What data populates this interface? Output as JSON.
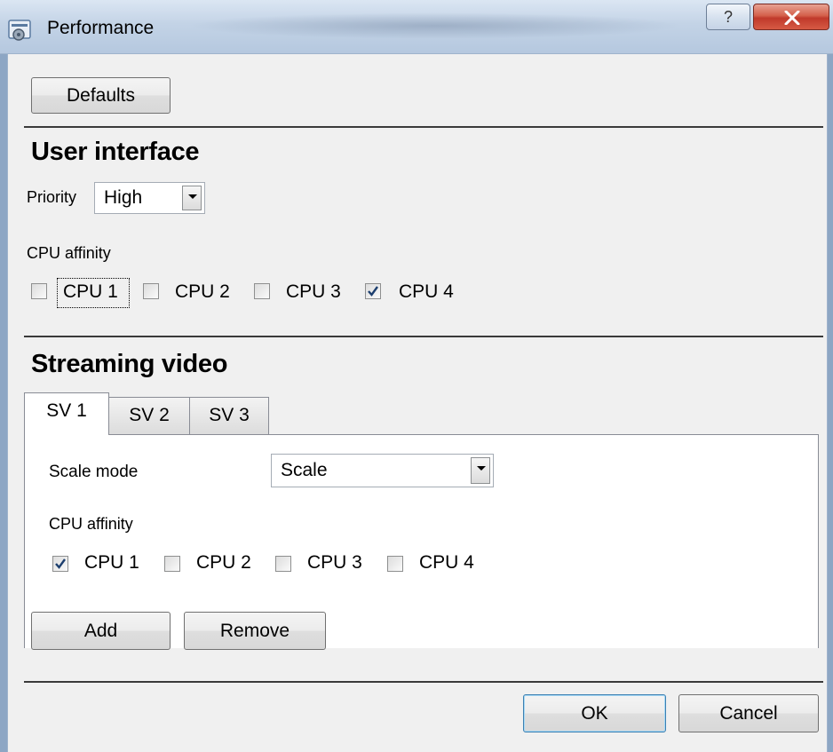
{
  "window": {
    "title": "Performance",
    "help_glyph": "?",
    "icons": {
      "app": "performance-app-icon",
      "help": "help-icon",
      "close": "close-icon"
    }
  },
  "defaults_button": "Defaults",
  "user_interface": {
    "heading": "User interface",
    "priority_label": "Priority",
    "priority_value": "High",
    "cpu_affinity_label": "CPU affinity",
    "cpus": [
      {
        "label": "CPU 1",
        "checked": false,
        "focused": true
      },
      {
        "label": "CPU 2",
        "checked": false
      },
      {
        "label": "CPU 3",
        "checked": false
      },
      {
        "label": "CPU 4",
        "checked": true
      }
    ]
  },
  "streaming_video": {
    "heading": "Streaming video",
    "tabs": [
      {
        "label": "SV 1",
        "active": true
      },
      {
        "label": "SV 2",
        "active": false
      },
      {
        "label": "SV 3",
        "active": false
      }
    ],
    "scale_mode_label": "Scale mode",
    "scale_mode_value": "Scale",
    "cpu_affinity_label": "CPU affinity",
    "cpus": [
      {
        "label": "CPU 1",
        "checked": true
      },
      {
        "label": "CPU 2",
        "checked": false
      },
      {
        "label": "CPU 3",
        "checked": false
      },
      {
        "label": "CPU 4",
        "checked": false
      }
    ],
    "add_button": "Add",
    "remove_button": "Remove"
  },
  "footer": {
    "ok_button": "OK",
    "cancel_button": "Cancel"
  },
  "colors": {
    "titlebar": "#c3d3e6",
    "close_button": "#c0392b",
    "dialog_bg": "#f0f0f0",
    "focus_border": "#3c7fb1"
  }
}
